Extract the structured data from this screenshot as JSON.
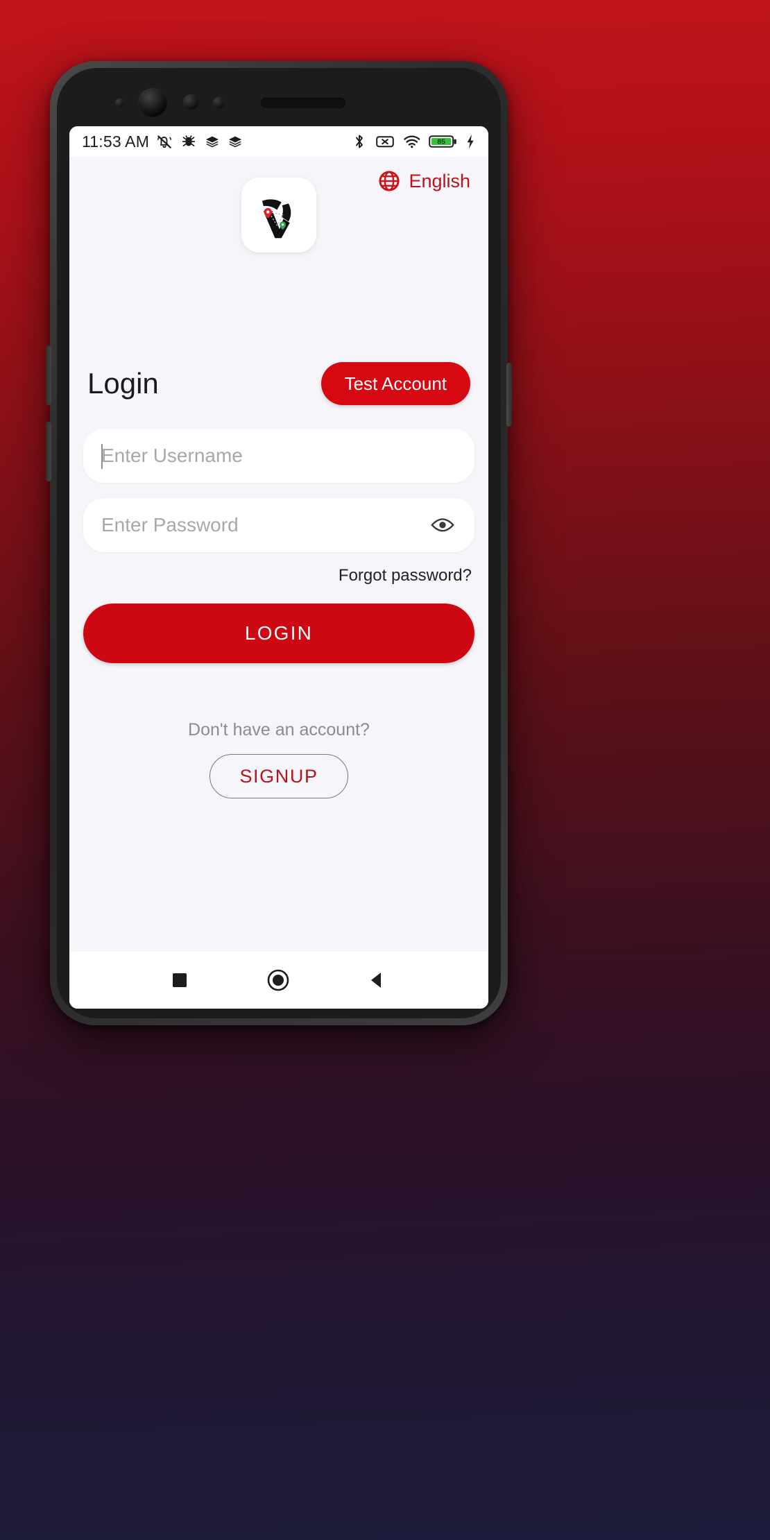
{
  "status_bar": {
    "time": "11:53 AM",
    "left_icons": [
      "silent-mode-icon",
      "bug-icon",
      "layers-icon",
      "layers-icon"
    ],
    "right_icons": [
      "bluetooth-icon",
      "sim-off-icon",
      "wifi-icon",
      "battery-icon",
      "charging-bolt-icon"
    ],
    "battery_percent": "85",
    "battery_color": "#36c23c"
  },
  "header": {
    "language_label": "English",
    "language_icon": "globe-icon",
    "language_color": "#b9121b",
    "logo_name": "app-logo"
  },
  "main": {
    "title": "Login",
    "test_account_label": "Test Account",
    "username": {
      "value": "",
      "placeholder": "Enter Username"
    },
    "password": {
      "value": "",
      "placeholder": "Enter Password",
      "toggle_icon": "eye-icon"
    },
    "forgot_password_label": "Forgot password?",
    "login_button_label": "LOGIN"
  },
  "footer": {
    "no_account_text": "Don't have an account?",
    "signup_label": "SIGNUP"
  },
  "nav_bar": {
    "recents": "square-icon",
    "home": "circle-icon",
    "back": "triangle-back-icon"
  },
  "theme": {
    "primary_red": "#ce0812",
    "accent_red": "#d60812",
    "link_red": "#b9121b",
    "screen_bg": "#f6f6fa"
  }
}
